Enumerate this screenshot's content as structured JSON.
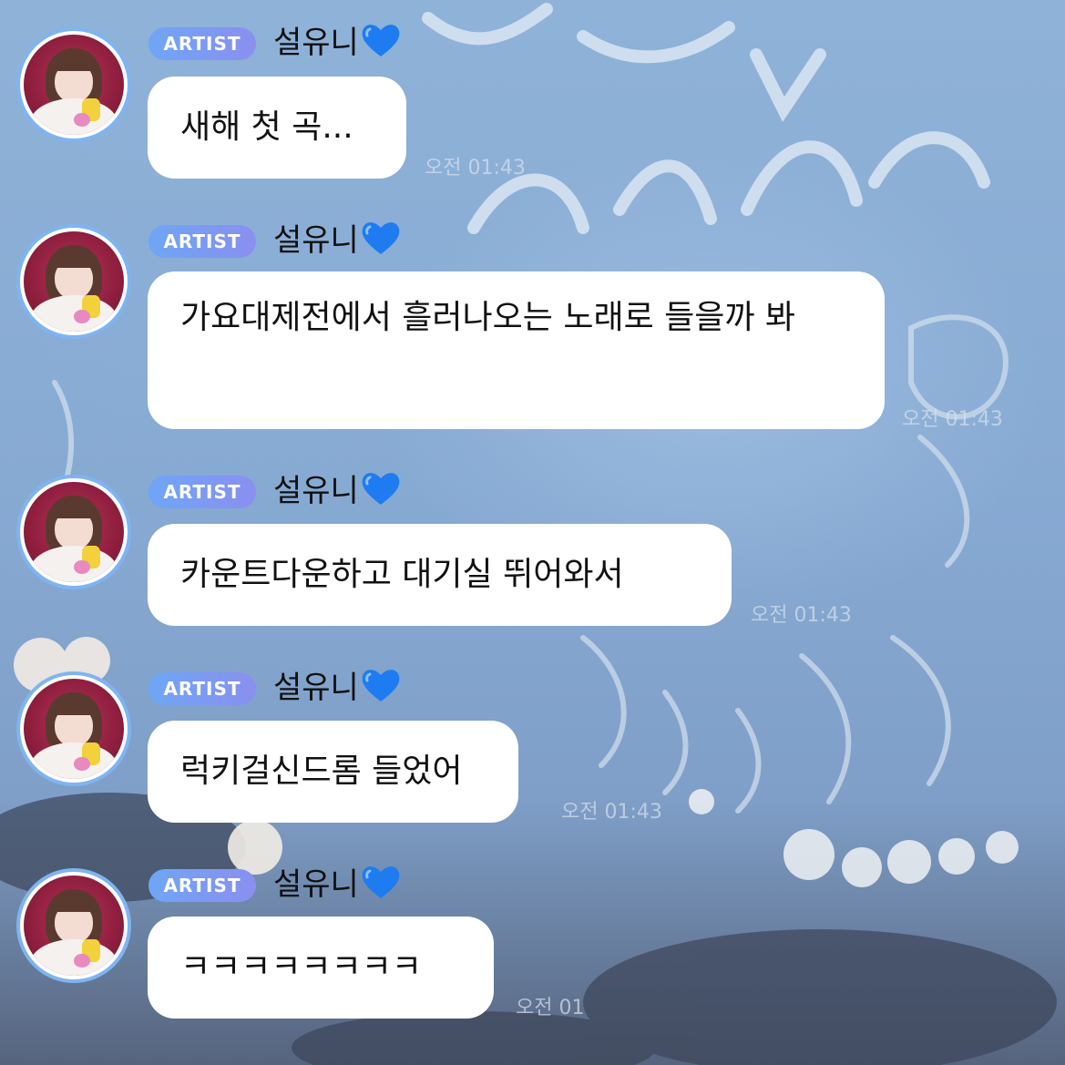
{
  "badge_label": "ARTIST",
  "sender_name": "설유니",
  "accent_colors": {
    "avatar_ring": "#7fb4f2",
    "badge_start": "#6ea6f5",
    "badge_end": "#8a8ff0",
    "heart": "#1f7cf0"
  },
  "icons": [
    "blue-heart-icon",
    "avatar"
  ],
  "messages": [
    {
      "text": "새해 첫 곡...",
      "time": "오전 01:43"
    },
    {
      "text": "가요대제전에서 흘러나오는 노래로 들을까 봐",
      "time": "오전 01:43"
    },
    {
      "text": "카운트다운하고 대기실 뛰어와서",
      "time": "오전 01:43"
    },
    {
      "text": "럭키걸신드롬 들었어",
      "time": "오전 01:43"
    },
    {
      "text": "ㅋㅋㅋㅋㅋㅋㅋㅋ",
      "time": "오전 01"
    }
  ]
}
